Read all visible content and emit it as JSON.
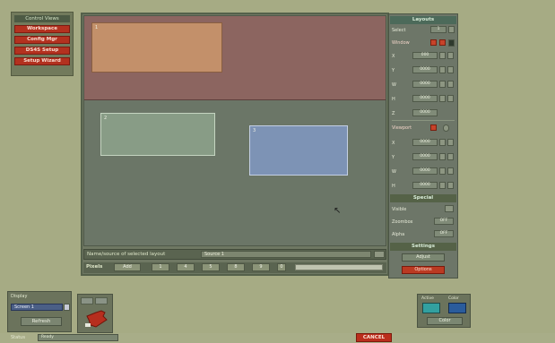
{
  "nav": {
    "header": "Control Views",
    "items": [
      "Workspace",
      "Config Mgr",
      "DS4S Setup",
      "Setup Wizard"
    ]
  },
  "canvas": {
    "windows": [
      {
        "id": "1"
      },
      {
        "id": "2"
      },
      {
        "id": "3"
      }
    ]
  },
  "info": {
    "label": "Name/source of selected layout",
    "name_value": "Source 1"
  },
  "pixels": {
    "label": "Pixels",
    "buttons": [
      "Add",
      "1",
      "4",
      "5",
      "8",
      "9",
      "0"
    ]
  },
  "rpanel": {
    "header": "Layouts",
    "select_label": "Select",
    "select_value": "1",
    "window_label": "Window",
    "window_fields": [
      {
        "label": "X",
        "value": "000"
      },
      {
        "label": "Y",
        "value": "0000"
      },
      {
        "label": "W",
        "value": "0000"
      },
      {
        "label": "H",
        "value": "0000"
      },
      {
        "label": "Z",
        "value": "0000"
      }
    ],
    "viewport_label": "Viewport",
    "viewport_fields": [
      {
        "label": "X",
        "value": "0000"
      },
      {
        "label": "Y",
        "value": "0000"
      },
      {
        "label": "W",
        "value": "0000"
      },
      {
        "label": "H",
        "value": "0000"
      }
    ],
    "special_header": "Special",
    "special_items": [
      {
        "label": "Visible",
        "value": ""
      },
      {
        "label": "Zoombox",
        "value": "OFF"
      },
      {
        "label": "Alpha",
        "value": "OFF"
      }
    ],
    "settings_header": "Settings",
    "settings_btn1": "Adjust",
    "settings_btn2": "Options"
  },
  "display": {
    "title": "Display",
    "select_value": "Screen 1",
    "refresh": "Refresh"
  },
  "colors": {
    "labels": [
      "Active",
      "Color"
    ],
    "swatches": [
      "#32a0a0",
      "#2a5c9c"
    ],
    "button": "Color"
  },
  "status": {
    "label": "Status",
    "value": "Ready",
    "cancel": "CANCEL"
  }
}
